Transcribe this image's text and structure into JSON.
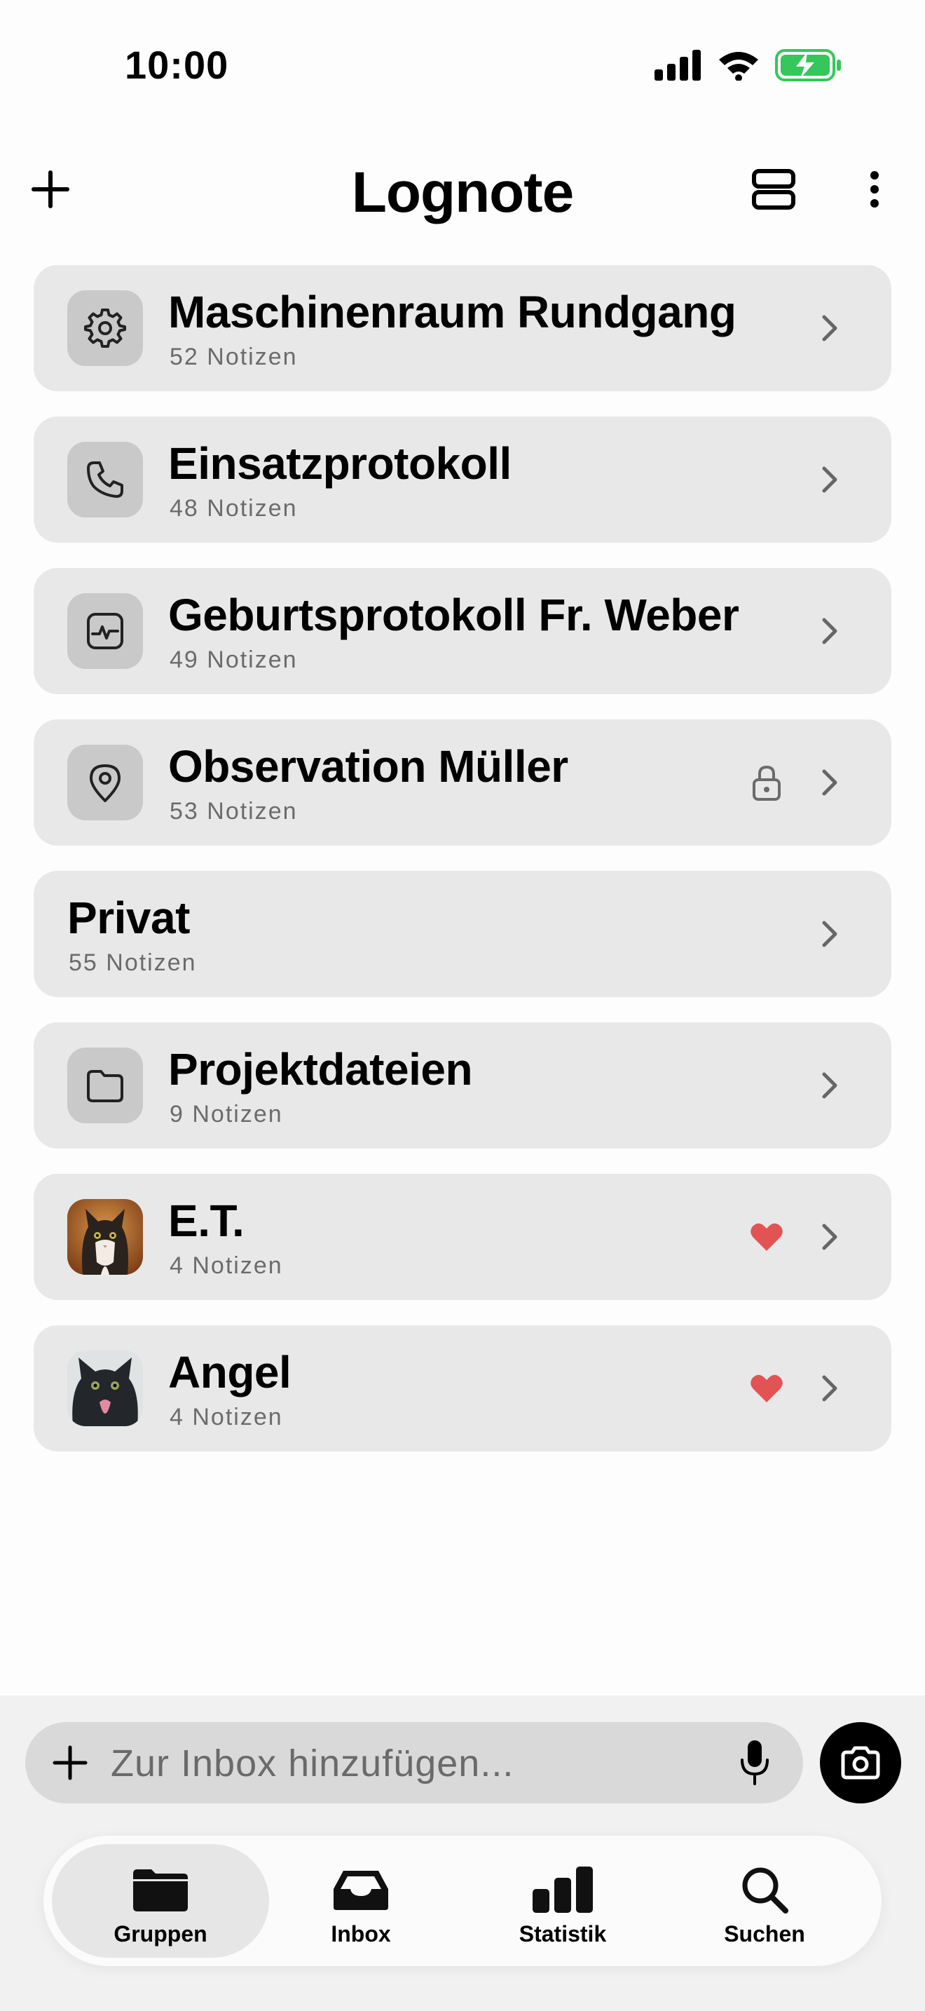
{
  "status_bar": {
    "time": "10:00"
  },
  "header": {
    "title": "Lognote",
    "add_icon": "plus-icon",
    "layout_icon": "list-layout-icon",
    "more_icon": "more-vertical-icon"
  },
  "groups": [
    {
      "title": "Maschinenraum Rundgang",
      "count": "52 Notizen",
      "icon": "gear-icon"
    },
    {
      "title": "Einsatzprotokoll",
      "count": "48 Notizen",
      "icon": "phone-icon"
    },
    {
      "title": "Geburtsprotokoll Fr. Weber",
      "count": "49 Notizen",
      "icon": "heart-monitor-icon"
    },
    {
      "title": "Observation Müller",
      "count": "53 Notizen",
      "icon": "location-pin-icon",
      "badge": "lock-icon"
    },
    {
      "title": "Privat",
      "count": "55 Notizen"
    },
    {
      "title": "Projektdateien",
      "count": "9 Notizen",
      "icon": "folder-icon"
    },
    {
      "title": "E.T.",
      "count": "4 Notizen",
      "icon": "cat-photo-avatar",
      "badge": "heart-icon"
    },
    {
      "title": "Angel",
      "count": "4 Notizen",
      "icon": "cat-photo-avatar",
      "badge": "heart-icon"
    }
  ],
  "composer": {
    "placeholder": "Zur Inbox hinzufügen..."
  },
  "tabs": [
    {
      "label": "Gruppen",
      "icon": "folder-icon",
      "active": true
    },
    {
      "label": "Inbox",
      "icon": "inbox-tray-icon"
    },
    {
      "label": "Statistik",
      "icon": "bar-chart-icon"
    },
    {
      "label": "Suchen",
      "icon": "search-icon"
    }
  ],
  "colors": {
    "card_background": "#e8e8e8",
    "heart": "#e25454",
    "battery": "#35c759"
  }
}
